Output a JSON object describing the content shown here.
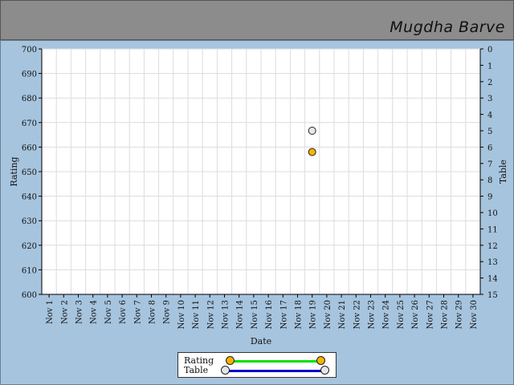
{
  "header": {
    "name": "Mugdha Barve"
  },
  "chart_data": {
    "type": "scatter",
    "xlabel": "Date",
    "ylabel_left": "Rating",
    "ylabel_right": "Table",
    "x_ticks": [
      "Nov 1",
      "Nov 2",
      "Nov 3",
      "Nov 4",
      "Nov 5",
      "Nov 6",
      "Nov 7",
      "Nov 8",
      "Nov 9",
      "Nov 10",
      "Nov 11",
      "Nov 12",
      "Nov 13",
      "Nov 14",
      "Nov 15",
      "Nov 16",
      "Nov 17",
      "Nov 18",
      "Nov 19",
      "Nov 20",
      "Nov 21",
      "Nov 22",
      "Nov 23",
      "Nov 24",
      "Nov 25",
      "Nov 26",
      "Nov 27",
      "Nov 28",
      "Nov 29",
      "Nov 30"
    ],
    "ylim_left": [
      600,
      700
    ],
    "y_ticks_left": [
      600,
      610,
      620,
      630,
      640,
      650,
      660,
      670,
      680,
      690,
      700
    ],
    "ylim_right": [
      15,
      0
    ],
    "y_ticks_right": [
      0,
      1,
      2,
      3,
      4,
      5,
      6,
      7,
      8,
      9,
      10,
      11,
      12,
      13,
      14,
      15
    ],
    "grid": true,
    "legend_position": "bottom-center",
    "series": [
      {
        "name": "Rating",
        "axis": "left",
        "line_color": "#00e000",
        "marker_color": "#f5b300",
        "points": [
          {
            "x": "Nov 19",
            "y": 658
          }
        ]
      },
      {
        "name": "Table",
        "axis": "right",
        "line_color": "#0000cc",
        "marker_color": "#e6e6e6",
        "points": [
          {
            "x": "Nov 19",
            "y": 5
          }
        ]
      }
    ]
  }
}
